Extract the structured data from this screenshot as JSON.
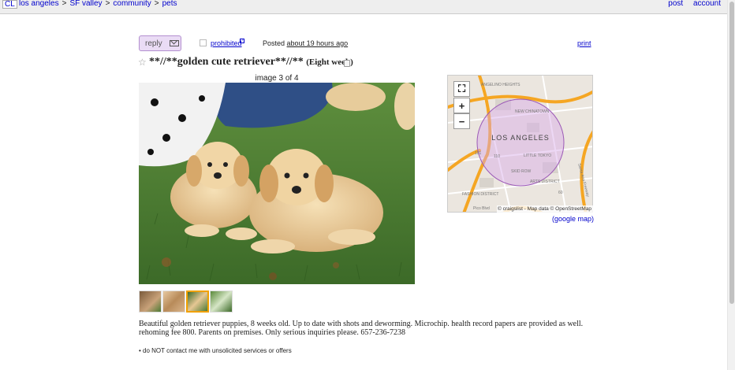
{
  "header": {
    "logo": "CL",
    "breadcrumbs": [
      "los angeles",
      "SF valley",
      "community",
      "pets"
    ],
    "separator": ">",
    "right_links": [
      "post",
      "account"
    ]
  },
  "actions": {
    "reply_label": "reply",
    "prohibited_label": "prohibited",
    "info_mark": "?",
    "posted_prefix": "Posted",
    "posted_when": "about 19 hours ago",
    "print_label": "print"
  },
  "posting": {
    "star": "☆",
    "title": "**//**golden cute retriever**//**",
    "location": "(Eight week)",
    "image_counter": "image 3 of 4",
    "thumbnail_count": 4,
    "active_thumbnail": 3,
    "body": "Beautiful golden retriever puppies, 8 weeks old. Up to date with shots and deworming. Microchip. health record papers are provided as well. rehoming fee 800. Parents on premises. Only serious inquiries please. 657-236-7238",
    "notices": [
      "do NOT contact me with unsolicited services or offers"
    ]
  },
  "map": {
    "city_label": "LOS ANGELES",
    "neighborhood_labels": [
      "ANGELINO HEIGHTS",
      "NEW CHINATOWN",
      "LITTLE TOKYO",
      "SKID ROW",
      "ARTS DISTRICT",
      "FASHION DISTRICT"
    ],
    "route_labels": [
      "101",
      "110",
      "60"
    ],
    "street_labels": [
      "Santa Ana Freeway",
      "Pico Blvd"
    ],
    "fullscreen_symbol": "⛶",
    "zoom_in": "+",
    "zoom_out": "−",
    "attribution": "© craigslist - Map data © OpenStreetMap",
    "google_map_label": "(google map)",
    "colors": {
      "land": "#ebe6df",
      "highway": "#f5a623",
      "circle_fill": "#d6a8e8",
      "circle_stroke": "#9b59b6"
    }
  }
}
